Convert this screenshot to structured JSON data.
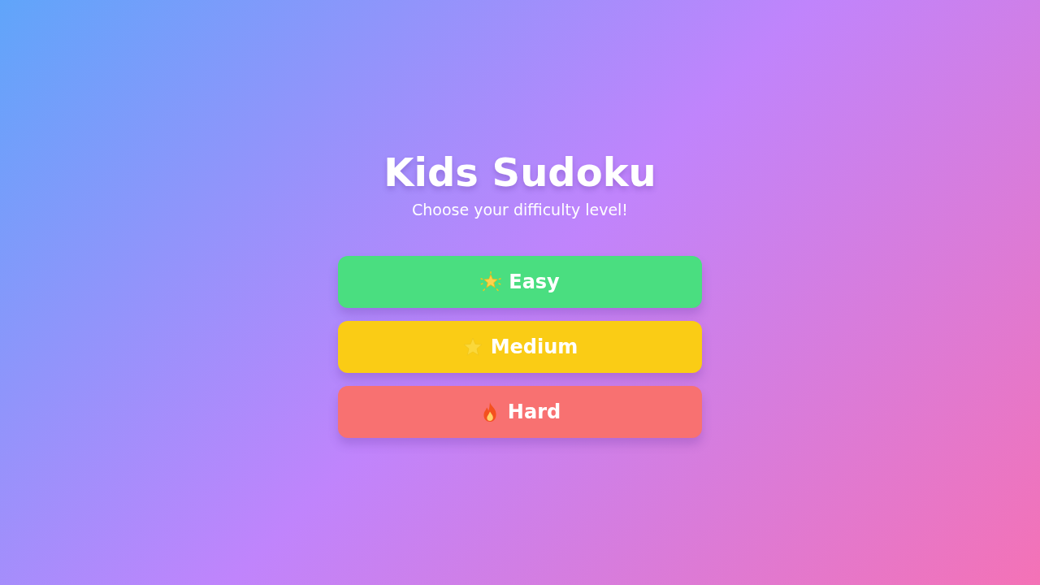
{
  "title": "Kids Sudoku",
  "subtitle": "Choose your difficulty level!",
  "levels": [
    {
      "label": "Easy",
      "kind": "glowstar",
      "color": "#4ade80"
    },
    {
      "label": "Medium",
      "kind": "star",
      "color": "#facc15"
    },
    {
      "label": "Hard",
      "kind": "fire",
      "color": "#f87171"
    }
  ]
}
